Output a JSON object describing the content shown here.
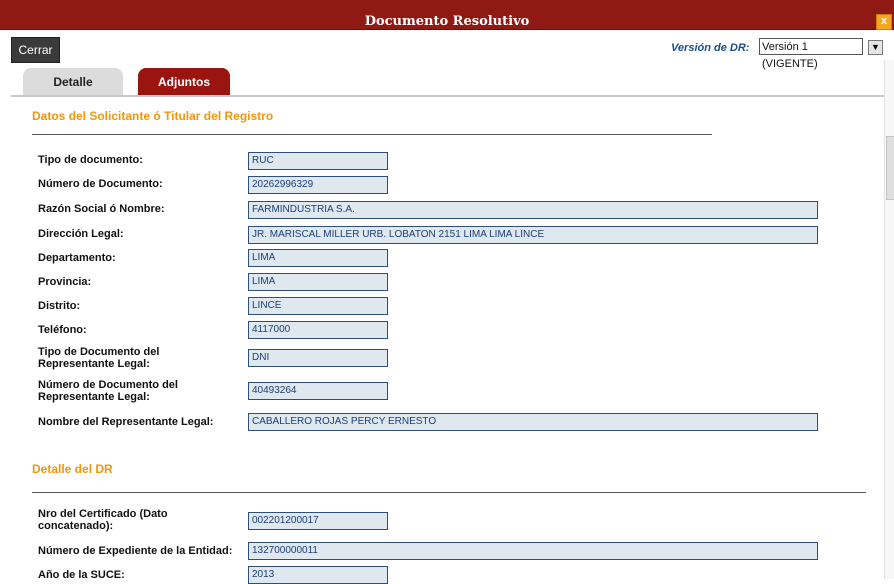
{
  "window": {
    "title": "Documento Resolutivo",
    "close_icon": "x"
  },
  "toolbar": {
    "cerrar": "Cerrar",
    "version_label": "Versión de DR:",
    "version_value": "Versión 1 (VIGENTE)"
  },
  "tabs": [
    {
      "label": "Detalle"
    },
    {
      "label": "Adjuntos"
    }
  ],
  "sections": {
    "solicitante": {
      "title": "Datos del Solicitante ó Titular del Registro",
      "fields": [
        {
          "label": "Tipo de documento:",
          "value": "RUC"
        },
        {
          "label": "Número de Documento:",
          "value": "20262996329"
        },
        {
          "label": "Razón Social ó Nombre:",
          "value": "FARMINDUSTRIA S.A."
        },
        {
          "label": "Dirección Legal:",
          "value": "JR. MARISCAL MILLER URB. LOBATON 2151 LIMA LIMA LINCE"
        },
        {
          "label": "Departamento:",
          "value": "LIMA"
        },
        {
          "label": "Provincia:",
          "value": "LIMA"
        },
        {
          "label": "Distrito:",
          "value": "LINCE"
        },
        {
          "label": "Teléfono:",
          "value": "4117000"
        },
        {
          "label_line1": "Tipo de Documento del",
          "label_line2": "Representante Legal:",
          "value": "DNI"
        },
        {
          "label_line1": "Número de Documento del",
          "label_line2": "Representante Legal:",
          "value": "40493264"
        },
        {
          "label": "Nombre del Representante Legal:",
          "value": "CABALLERO ROJAS PERCY ERNESTO"
        }
      ]
    },
    "detalle": {
      "title": "Detalle del DR",
      "fields": [
        {
          "label_line1": "Nro del Certificado (Dato",
          "label_line2": "concatenado):",
          "value": "002201200017"
        },
        {
          "label": "Número de Expediente de la Entidad:",
          "value": "132700000011"
        },
        {
          "label": "Año de la SUCE:",
          "value": "2013"
        }
      ]
    }
  },
  "colors": {
    "titlebar": "#8f1a14",
    "section_title": "#f0960f",
    "field_bg": "#dfe7ef",
    "field_border": "#2e4f7a"
  }
}
